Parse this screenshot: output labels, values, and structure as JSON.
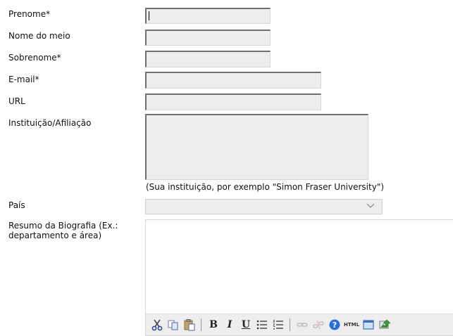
{
  "form": {
    "labels": {
      "first_name": "Prenome*",
      "middle_name": "Nome do meio",
      "last_name": "Sobrenome*",
      "email": "E-mail*",
      "url": "URL",
      "affiliation": "Instituição/Afiliação",
      "country": "País",
      "bio": "Resumo da Biografia (Ex.: departamento e área)"
    },
    "values": {
      "first_name": "",
      "middle_name": "",
      "last_name": "",
      "email": "",
      "url": "",
      "affiliation": "",
      "country": "",
      "bio": ""
    },
    "affiliation_hint": "(Sua instituição, por exemplo \"Simon Fraser University\")"
  },
  "toolbar": {
    "buttons": [
      "cut-icon",
      "copy-icon",
      "paste-icon",
      "bold",
      "italic",
      "underline",
      "bulleted-list-icon",
      "numbered-list-icon",
      "link-icon",
      "unlink-icon",
      "help-icon",
      "html-icon",
      "fullscreen-icon",
      "image-icon"
    ],
    "bold_label": "B",
    "italic_label": "I",
    "underline_label": "U",
    "html_label": "HTML"
  },
  "colors": {
    "field_bg": "#ededed",
    "field_border_dark": "#707070",
    "toolbar_bg": "#eeeeee",
    "help_icon": "#2a6fd6"
  }
}
